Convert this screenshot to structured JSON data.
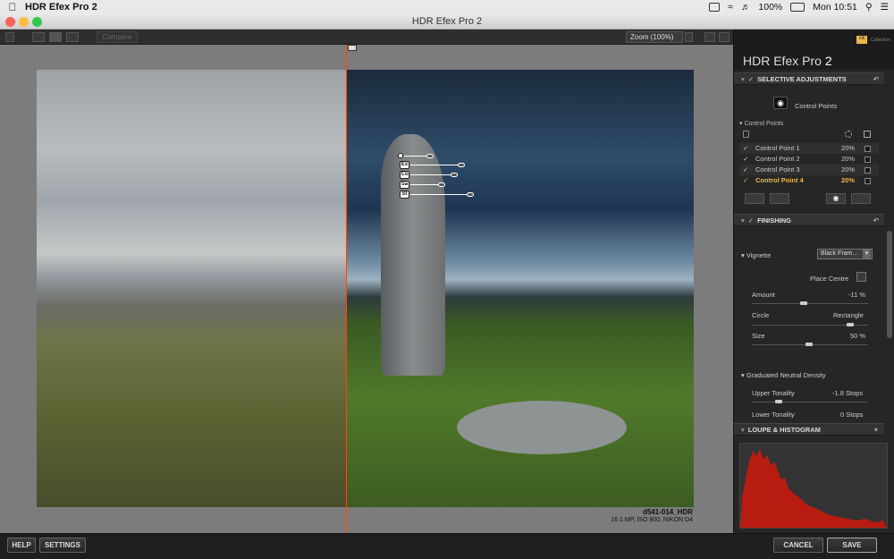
{
  "menubar": {
    "app_name": "HDR Efex Pro 2",
    "battery": "100%",
    "clock": "Mon 10:51"
  },
  "window": {
    "title": "HDR Efex Pro 2"
  },
  "toolbar": {
    "compare_label": "Compare",
    "zoom_label": "Zoom (100%)"
  },
  "image": {
    "filename": "d541-014_HDR",
    "meta": "16.1 MP, ISO 800, NIKON D4",
    "control_point_labels": [
      "Ex",
      "Co",
      "Sa",
      "St"
    ]
  },
  "panel": {
    "brand_title": "HDR Efex Pro",
    "brand_version": "2",
    "brand_badge": "nik",
    "brand_collection": "Collection",
    "selective": {
      "header": "SELECTIVE ADJUSTMENTS",
      "control_points_button": "Control Points",
      "list_header": "Control Points",
      "items": [
        {
          "name": "Control Point 1",
          "value": "20%"
        },
        {
          "name": "Control Point 2",
          "value": "20%"
        },
        {
          "name": "Control Point 3",
          "value": "20%"
        },
        {
          "name": "Control Point 4",
          "value": "20%"
        }
      ]
    },
    "finishing": {
      "header": "FINISHING",
      "vignette_label": "Vignette",
      "vignette_value": "Black Fram...",
      "place_centre": "Place Centre",
      "amount_label": "Amount",
      "amount_value": "-11 %",
      "circle_label": "Circle",
      "rectangle_label": "Rectangle",
      "size_label": "Size",
      "size_value": "50 %",
      "gnd_label": "Graduated Neutral Density",
      "upper_label": "Upper Tonality",
      "upper_value": "-1.8 Stops",
      "lower_label": "Lower Tonality",
      "lower_value": "0 Stops"
    },
    "loupe": {
      "header": "LOUPE & HISTOGRAM"
    }
  },
  "footer": {
    "help": "HELP",
    "settings": "SETTINGS",
    "cancel": "CANCEL",
    "save": "SAVE"
  },
  "colors": {
    "accent": "#e8b84a",
    "divider": "#d2582c",
    "histogram": "#b81c10"
  }
}
